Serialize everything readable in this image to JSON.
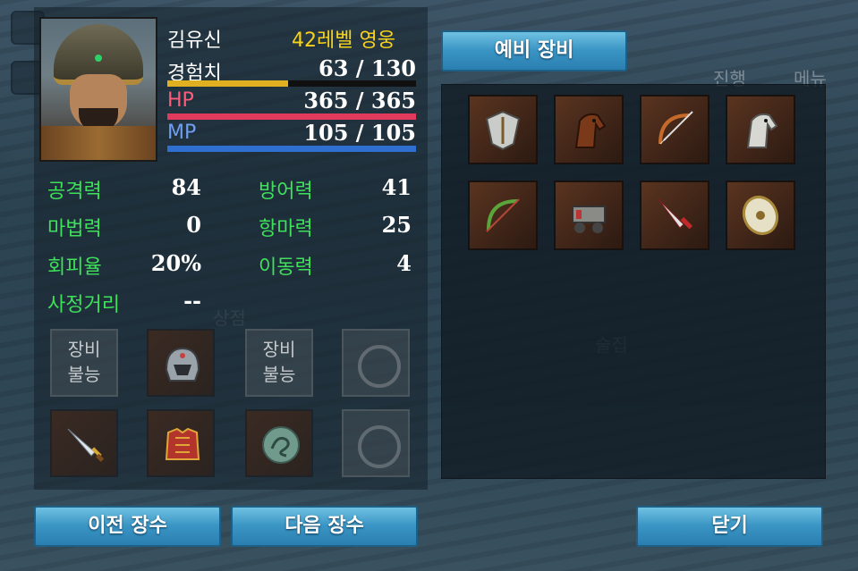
{
  "background": {
    "labels": [
      "상점",
      "술집",
      "진행",
      "메뉴"
    ]
  },
  "hero": {
    "name": "김유신",
    "level": "42레벨 영웅",
    "exp_label": "경험치",
    "exp_value": "63 / 130",
    "exp_fraction": 0.485,
    "hp_label": "HP",
    "hp_value": "365 / 365",
    "hp_fraction": 1.0,
    "mp_label": "MP",
    "mp_value": "105 / 105",
    "mp_fraction": 1.0
  },
  "attributes": [
    {
      "label": "공격력",
      "value": "84"
    },
    {
      "label": "방어력",
      "value": "41"
    },
    {
      "label": "마법력",
      "value": "0"
    },
    {
      "label": "항마력",
      "value": "25"
    },
    {
      "label": "회피율",
      "value": "20%"
    },
    {
      "label": "이동력",
      "value": "4"
    },
    {
      "label": "사정거리",
      "value": "--"
    }
  ],
  "equipment": {
    "unavailable_line1": "장비",
    "unavailable_line2": "불능",
    "slots": [
      {
        "icon": "unavailable-slot"
      },
      {
        "icon": "helmet-icon"
      },
      {
        "icon": "unavailable-slot"
      },
      {
        "icon": "ring-empty-icon"
      },
      {
        "icon": "sword-icon"
      },
      {
        "icon": "armor-icon"
      },
      {
        "icon": "dragon-coin-icon"
      },
      {
        "icon": "ring-empty-icon"
      }
    ]
  },
  "reserve": {
    "title": "예비 장비",
    "items": [
      "shield-icon",
      "horse-brown-icon",
      "bow-icon",
      "horse-white-icon",
      "green-bow-icon",
      "siege-cart-icon",
      "red-sword-icon",
      "gold-shield-icon"
    ]
  },
  "buttons": {
    "prev": "이전 장수",
    "next": "다음 장수",
    "close": "닫기"
  },
  "colors": {
    "exp_bar": "#e0b020",
    "hp_bar": "#e23a5c",
    "mp_bar": "#2f6fd0",
    "stat_label_green": "#3fe05a",
    "level_yellow": "#f7d21c",
    "button_blue": "#3a95c4"
  }
}
